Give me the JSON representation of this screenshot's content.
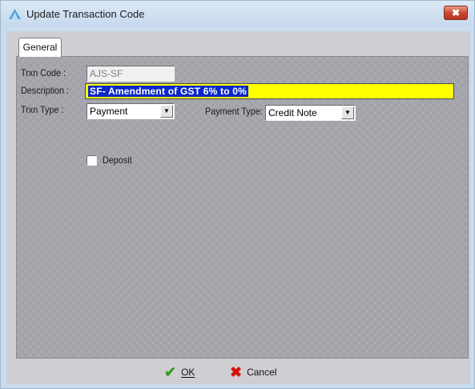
{
  "window": {
    "title": "Update Transaction Code",
    "close_glyph": "✖",
    "title_icon": "triangle-app-icon"
  },
  "tabs": [
    {
      "label": "General",
      "selected": true
    }
  ],
  "form": {
    "trxn_code_label": "Trxn Code :",
    "trxn_code_value": "AJS-SF",
    "description_label": "Description :",
    "description_value": "SF- Amendment of GST 6% to 0%",
    "trxn_type_label": "Trxn Type :",
    "trxn_type_value": "Payment",
    "payment_type_label": "Payment Type:",
    "payment_type_value": "Credit Note",
    "deposit_label": "Deposit",
    "deposit_checked": false,
    "dropdown_glyph": "▼"
  },
  "buttons": {
    "ok_label": "OK",
    "ok_icon": "✔",
    "cancel_label": "Cancel",
    "cancel_icon": "✖"
  },
  "colors": {
    "description_highlight": "#ffff00",
    "selection": "#0a27c9",
    "ok_icon": "#3a9a1e",
    "cancel_icon": "#d4130b"
  }
}
